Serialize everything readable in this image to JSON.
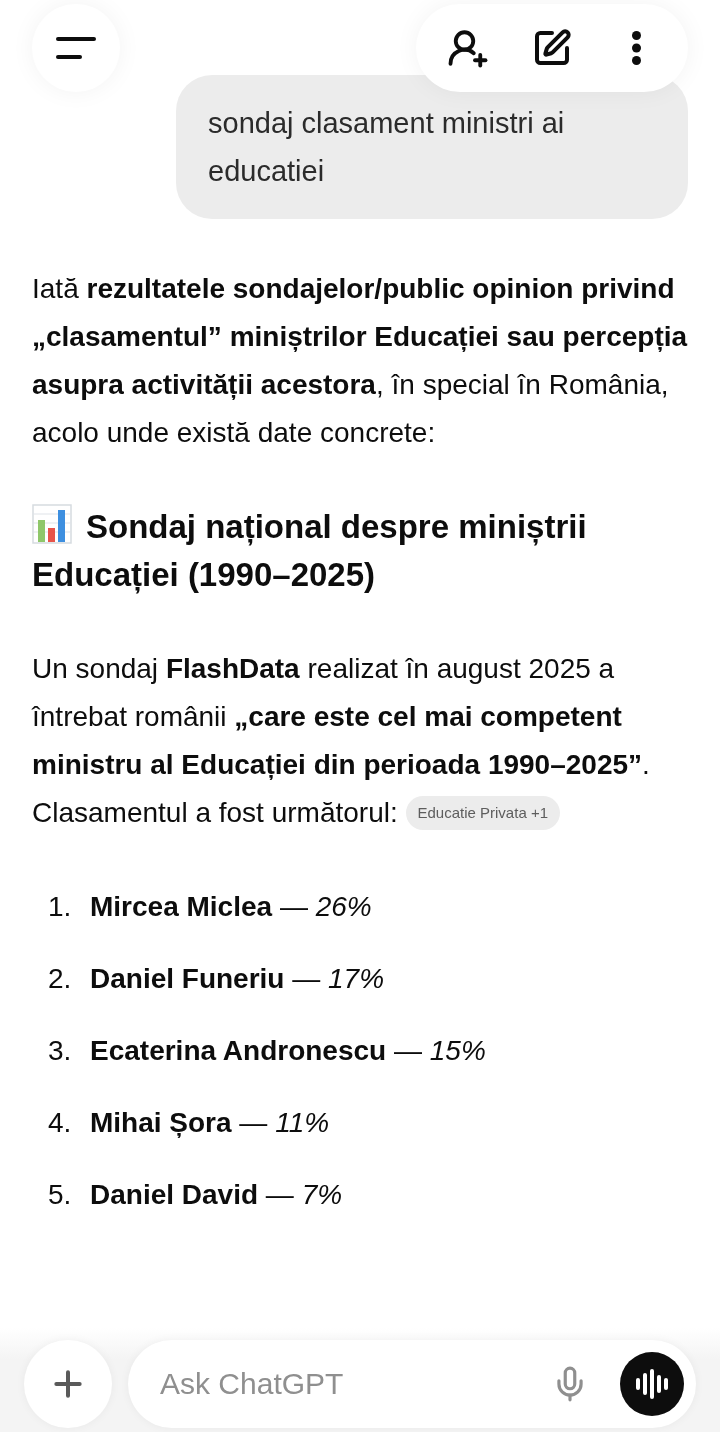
{
  "user_message": {
    "text": "sondaj clasament ministri ai educatiei"
  },
  "response": {
    "intro": "Iată **rezultatele sondajelor/public opinion privind „clasamentul” miniștrilor Educației sau percepția asupra activității acestora**, în special în România, acolo unde există date concrete:",
    "heading": "Sondaj național despre miniștrii Educației (1990–2025)",
    "paragraph": "Un sondaj **FlashData** realizat în august 2025 a întrebat românii **„care este cel mai competent ministru al Educației din perioada 1990–2025”**. Clasamentul a fost următorul:",
    "source_chip": "Educatie Privata +1",
    "ranking": [
      {
        "number": "1.",
        "text": "**Mircea Miclea** — *26%*"
      },
      {
        "number": "2.",
        "text": "**Daniel Funeriu** — *17%*"
      },
      {
        "number": "3.",
        "text": "**Ecaterina Andronescu** — *15%*"
      },
      {
        "number": "4.",
        "text": "**Mihai Șora** — *11%*"
      },
      {
        "number": "5.",
        "text": "**Daniel David** — *7%*"
      }
    ]
  },
  "composer": {
    "placeholder": "Ask ChatGPT"
  }
}
